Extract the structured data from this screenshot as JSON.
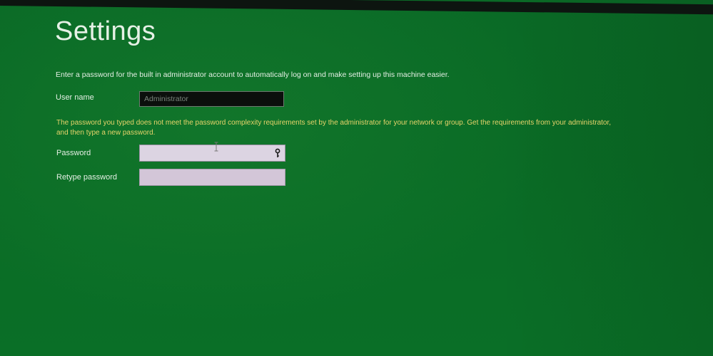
{
  "page": {
    "title": "Settings",
    "intro": "Enter a password for the built in administrator account to automatically log on and make setting up this machine easier."
  },
  "form": {
    "username_label": "User name",
    "username_value": "Administrator",
    "error_message": "The password you typed does not meet the password complexity requirements set by the administrator for your network or group. Get the requirements from your administrator, and then type a new password.",
    "password_label": "Password",
    "password_value": "",
    "retype_label": "Retype password",
    "retype_value": ""
  },
  "icons": {
    "reveal": "key-reveal-icon",
    "cursor": "text-cursor-icon"
  },
  "colors": {
    "background": "#0b6a24",
    "error_text": "#e6d36a",
    "text": "#e4efe4"
  }
}
